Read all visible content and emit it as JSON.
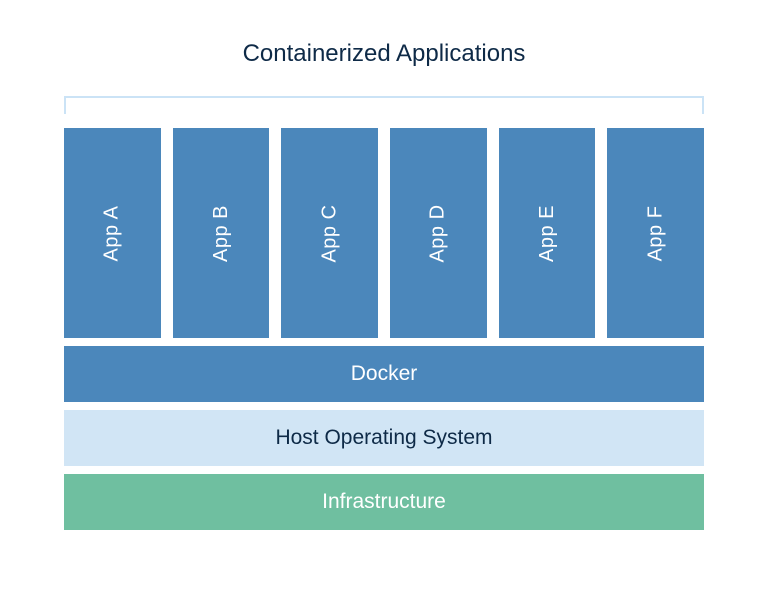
{
  "title": "Containerized Applications",
  "apps": [
    "App A",
    "App B",
    "App C",
    "App D",
    "App E",
    "App F"
  ],
  "layers": {
    "docker": "Docker",
    "host": "Host Operating System",
    "infra": "Infrastructure"
  },
  "colors": {
    "app_fill": "#4B87BB",
    "docker_fill": "#4B87BB",
    "host_fill": "#D1E5F5",
    "infra_fill": "#6FBFA0",
    "bracket": "#CBE3F6",
    "text_dark": "#0E2A47",
    "text_light": "#ffffff"
  }
}
